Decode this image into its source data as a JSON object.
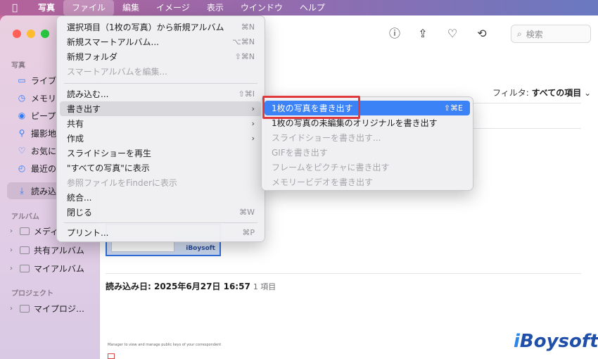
{
  "menubar": {
    "items": [
      {
        "label": "写真"
      },
      {
        "label": "ファイル"
      },
      {
        "label": "編集"
      },
      {
        "label": "イメージ"
      },
      {
        "label": "表示"
      },
      {
        "label": "ウインドウ"
      },
      {
        "label": "ヘルプ"
      }
    ]
  },
  "sidebar": {
    "section_photos": "写真",
    "items": [
      {
        "label": "ライブ",
        "icon": "rectangle-stack-icon"
      },
      {
        "label": "メモリ",
        "icon": "memories-icon"
      },
      {
        "label": "ピープ",
        "icon": "person-icon"
      },
      {
        "label": "撮影地",
        "icon": "pin-icon"
      },
      {
        "label": "お気に",
        "icon": "heart-icon"
      },
      {
        "label": "最近の",
        "icon": "clock-icon"
      },
      {
        "label": "読み込",
        "icon": "import-icon"
      }
    ],
    "section_albums": "アルバム",
    "albums": [
      {
        "label": "メディ"
      },
      {
        "label": "共有アルバム"
      },
      {
        "label": "マイアルバム"
      }
    ],
    "section_projects": "プロジェクト",
    "projects": [
      {
        "label": "マイプロジ…"
      }
    ]
  },
  "toolbar": {
    "search_placeholder": "検索"
  },
  "main": {
    "filter_label": "フィルタ: ",
    "filter_value": "すべての項目",
    "thumb_brand": "iBoysoft",
    "import_heading": "読み込み日: 2025年6月27日 16:57",
    "import_count": "1 項目",
    "tiny_text": "Manager to view and manage public keys of your correspondent"
  },
  "file_menu": {
    "items": [
      {
        "label": "選択項目（1枚の写真）から新規アルバム",
        "shortcut": "⌘N"
      },
      {
        "label": "新規スマートアルバム...",
        "shortcut": "⌥⌘N"
      },
      {
        "label": "新規フォルダ",
        "shortcut": "⇧⌘N"
      },
      {
        "label": "スマートアルバムを編集..."
      },
      {
        "label": "読み込む...",
        "shortcut": "⇧⌘I"
      },
      {
        "label": "書き出す"
      },
      {
        "label": "共有"
      },
      {
        "label": "作成"
      },
      {
        "label": "スライドショーを再生"
      },
      {
        "label": "\"すべての写真\"に表示"
      },
      {
        "label": "参照ファイルをFinderに表示"
      },
      {
        "label": "統合..."
      },
      {
        "label": "閉じる",
        "shortcut": "⌘W"
      },
      {
        "label": "プリント...",
        "shortcut": "⌘P"
      }
    ]
  },
  "export_submenu": {
    "items": [
      {
        "label": "1枚の写真を書き出す",
        "shortcut": "⇧⌘E"
      },
      {
        "label": "1枚の写真の未編集のオリジナルを書き出す"
      },
      {
        "label": "スライドショーを書き出す..."
      },
      {
        "label": "GIFを書き出す"
      },
      {
        "label": "フレームをピクチャに書き出す"
      },
      {
        "label": "メモリービデオを書き出す"
      }
    ]
  },
  "watermark": {
    "prefix": "i",
    "text": "Boysoft"
  },
  "colors": {
    "accent": "#3b82f6",
    "highlight_box": "#e0393e",
    "sidebar_icon": "#2f7cf6"
  }
}
